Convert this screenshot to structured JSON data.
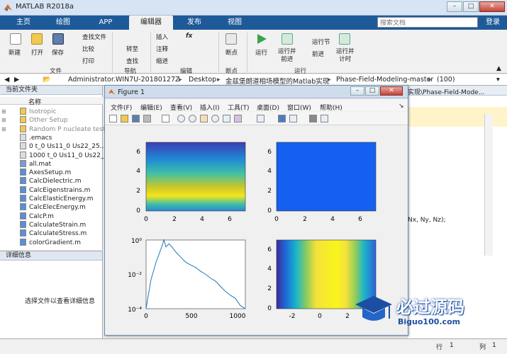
{
  "window": {
    "title": "MATLAB R2018a"
  },
  "tabs": [
    "主页",
    "绘图",
    "APP",
    "编辑器",
    "发布",
    "视图"
  ],
  "search": {
    "placeholder": "搜索文档"
  },
  "login": "登录",
  "ribbon": {
    "file": {
      "new": "新建",
      "open": "打开",
      "save": "保存",
      "find_files": "查找文件",
      "compare": "比较",
      "print": "打印",
      "group": "文件"
    },
    "navigate": {
      "goto": "转至",
      "find": "查找",
      "group": "导航"
    },
    "edit": {
      "insert": "插入",
      "comment": "注释",
      "indent": "缩进",
      "fx": "fx",
      "group": "编辑"
    },
    "breakpoints": {
      "label": "断点",
      "group": "断点"
    },
    "run": {
      "run": "运行",
      "run_advance": "运行并\n前进",
      "run_section": "运行节",
      "advance": "前进",
      "run_time": "运行并\n计时",
      "group": "运行"
    }
  },
  "path": {
    "crumbs": [
      "Administrator.WIN7U-20180127Z",
      "Desktop",
      "金兹堡朗道相场模型的Matlab实现",
      "Phase-Field-Modeling-master",
      "(100)"
    ],
    "separator": "▸"
  },
  "current_folder": {
    "title": "当前文件夹",
    "column": "名称",
    "items": [
      {
        "name": "Isotropic",
        "type": "folder"
      },
      {
        "name": "Other Setup",
        "type": "folder"
      },
      {
        "name": "Random P nucleate test",
        "type": "folder"
      },
      {
        "name": ".emacs",
        "type": "file"
      },
      {
        "name": "0 t_0 Us11_0 Us22_25...",
        "type": "file"
      },
      {
        "name": "1000 t_0 Us11_0 Us22_...",
        "type": "file"
      },
      {
        "name": "all.mat",
        "type": "mat"
      },
      {
        "name": "AxesSetup.m",
        "type": "m"
      },
      {
        "name": "CalcDielectric.m",
        "type": "m"
      },
      {
        "name": "CalcEigenstrains.m",
        "type": "m"
      },
      {
        "name": "CalcElasticEnergy.m",
        "type": "m"
      },
      {
        "name": "CalcElecEnergy.m",
        "type": "m"
      },
      {
        "name": "CalcP.m",
        "type": "m"
      },
      {
        "name": "CalculateStrain.m",
        "type": "m"
      },
      {
        "name": "CalculateStress.m",
        "type": "m"
      },
      {
        "name": "colorGradient.m",
        "type": "m"
      }
    ]
  },
  "details": {
    "title": "详细信息",
    "message": "选择文件以查看详细信息"
  },
  "editor_snippets": {
    "tab_path": "实现\\Phase-Field-Mode...",
    "code_line": "Nx, Ny, Nz);"
  },
  "status": {
    "row_label": "行",
    "row": "1",
    "col_label": "列",
    "col": "1"
  },
  "figure": {
    "title": "Figure 1",
    "menu": [
      "文件(F)",
      "编辑(E)",
      "查看(V)",
      "插入(I)",
      "工具(T)",
      "桌面(D)",
      "窗口(W)",
      "帮助(H)"
    ],
    "plots": {
      "p1": {
        "yticks": [
          "6",
          "4",
          "2",
          "0"
        ],
        "xticks": [
          "0",
          "2",
          "4",
          "6"
        ]
      },
      "p2": {
        "yticks": [
          "6",
          "4",
          "2",
          "0"
        ],
        "xticks": [
          "0",
          "2",
          "4",
          "6"
        ]
      },
      "p3": {
        "yticks": [
          "10⁰",
          "10⁻²",
          "10⁻⁴"
        ],
        "xticks": [
          "0",
          "500",
          "1000"
        ]
      },
      "p4": {
        "yticks": [
          "6",
          "4",
          "2",
          "0"
        ],
        "xticks": [
          "-2",
          "0",
          "2"
        ]
      }
    }
  },
  "chart_data": {
    "type": "line",
    "yscale": "log",
    "x": [
      0,
      20,
      50,
      100,
      150,
      180,
      200,
      230,
      260,
      300,
      350,
      400,
      450,
      500,
      550,
      600,
      650,
      700,
      750,
      800,
      850,
      900,
      950,
      1000
    ],
    "y": [
      0.0001,
      0.0005,
      0.005,
      0.05,
      0.3,
      1.0,
      0.4,
      0.6,
      0.4,
      0.2,
      0.1,
      0.05,
      0.035,
      0.025,
      0.015,
      0.01,
      0.006,
      0.004,
      0.002,
      0.001,
      0.0006,
      0.0004,
      0.00015,
      0.0001
    ],
    "xlim": [
      0,
      1000
    ],
    "ylim": [
      0.0001,
      1
    ],
    "color": "#1f77b4"
  },
  "watermark": {
    "cn": "必过源码",
    "en": "Biguo100.com"
  }
}
